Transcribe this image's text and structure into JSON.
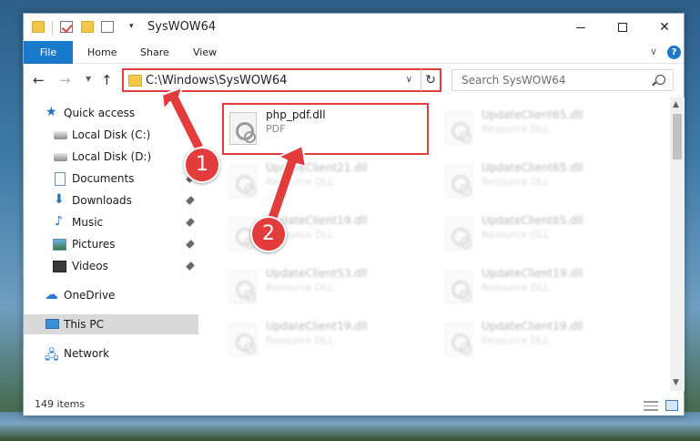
{
  "window": {
    "title": "SysWOW64"
  },
  "ribbon": {
    "tabs": [
      "File",
      "Home",
      "Share",
      "View"
    ]
  },
  "address": {
    "path": "C:\\Windows\\SysWOW64"
  },
  "search": {
    "placeholder": "Search SysWOW64"
  },
  "navpane": {
    "items": [
      {
        "label": "Quick access",
        "icon": "star-icon"
      },
      {
        "label": "Local Disk (C:)",
        "icon": "drive-icon"
      },
      {
        "label": "Local Disk (D:)",
        "icon": "drive-icon"
      },
      {
        "label": "Documents",
        "icon": "documents-icon",
        "pinned": true
      },
      {
        "label": "Downloads",
        "icon": "download-icon",
        "pinned": true
      },
      {
        "label": "Music",
        "icon": "music-icon",
        "pinned": true
      },
      {
        "label": "Pictures",
        "icon": "pictures-icon",
        "pinned": true
      },
      {
        "label": "Videos",
        "icon": "videos-icon",
        "pinned": true
      },
      {
        "label": "OneDrive",
        "icon": "cloud-icon"
      },
      {
        "label": "This PC",
        "icon": "pc-icon",
        "selected": true
      },
      {
        "label": "Network",
        "icon": "network-icon"
      }
    ]
  },
  "files": [
    {
      "name": "php_pdf.dll",
      "type": "PDF",
      "highlighted": true
    },
    {
      "name": "UpdateClient65.dll",
      "type": "Resource DLL"
    },
    {
      "name": "UpdateClient21.dll",
      "type": "Resource DLL"
    },
    {
      "name": "UpdateClient65.dll",
      "type": "Resource DLL"
    },
    {
      "name": "UpdateClient19.dll",
      "type": "Resource DLL"
    },
    {
      "name": "UpdateClient65.dll",
      "type": "Resource DLL"
    },
    {
      "name": "UpdateClient53.dll",
      "type": "Resource DLL"
    },
    {
      "name": "UpdateClient19.dll",
      "type": "Resource DLL"
    },
    {
      "name": "UpdateClient19.dll",
      "type": "Resource DLL"
    },
    {
      "name": "UpdateClient19.dll",
      "type": "Resource DLL"
    }
  ],
  "status": {
    "item_count": "149 items"
  },
  "annotations": {
    "step1": "1",
    "step2": "2",
    "color": "#e23c3c"
  }
}
